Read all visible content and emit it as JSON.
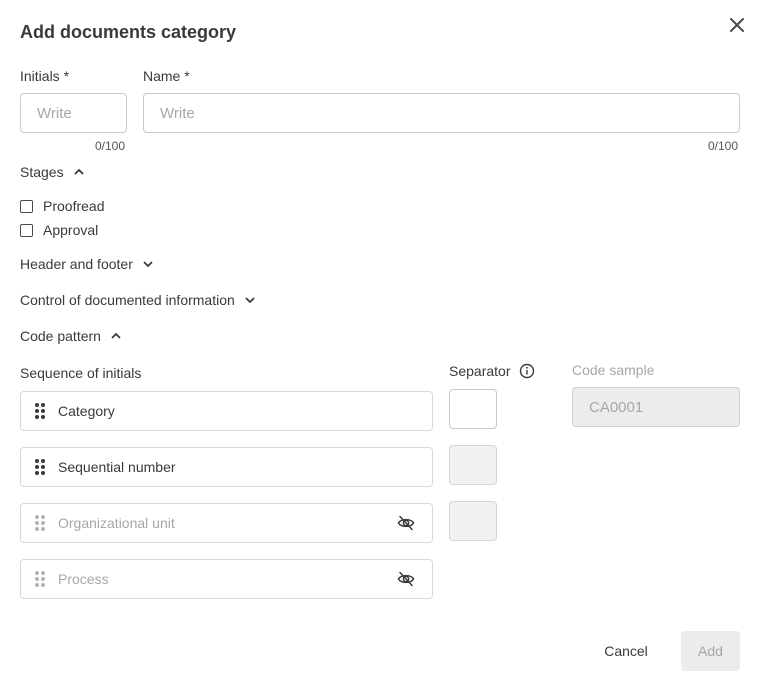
{
  "dialog": {
    "title": "Add documents category"
  },
  "fields": {
    "initials": {
      "label": "Initials *",
      "placeholder": "Write",
      "counter": "0/100"
    },
    "name": {
      "label": "Name *",
      "placeholder": "Write",
      "counter": "0/100"
    }
  },
  "stages": {
    "label": "Stages",
    "options": [
      {
        "label": "Proofread",
        "checked": false
      },
      {
        "label": "Approval",
        "checked": false
      }
    ]
  },
  "sections": {
    "header_footer": "Header and footer",
    "control_info": "Control of documented information",
    "code_pattern": "Code pattern"
  },
  "code_pattern": {
    "sequence_label": "Sequence of initials",
    "separator_label": "Separator",
    "code_sample_label": "Code sample",
    "code_sample_value": "CA0001",
    "items": [
      {
        "label": "Category",
        "enabled": true
      },
      {
        "label": "Sequential number",
        "enabled": true
      },
      {
        "label": "Organizational unit",
        "enabled": false
      },
      {
        "label": "Process",
        "enabled": false
      }
    ]
  },
  "buttons": {
    "cancel": "Cancel",
    "add": "Add"
  },
  "colors": {
    "text": "#3a3a3a",
    "muted": "#a7a7a7",
    "disabled_bg": "#ececec"
  }
}
